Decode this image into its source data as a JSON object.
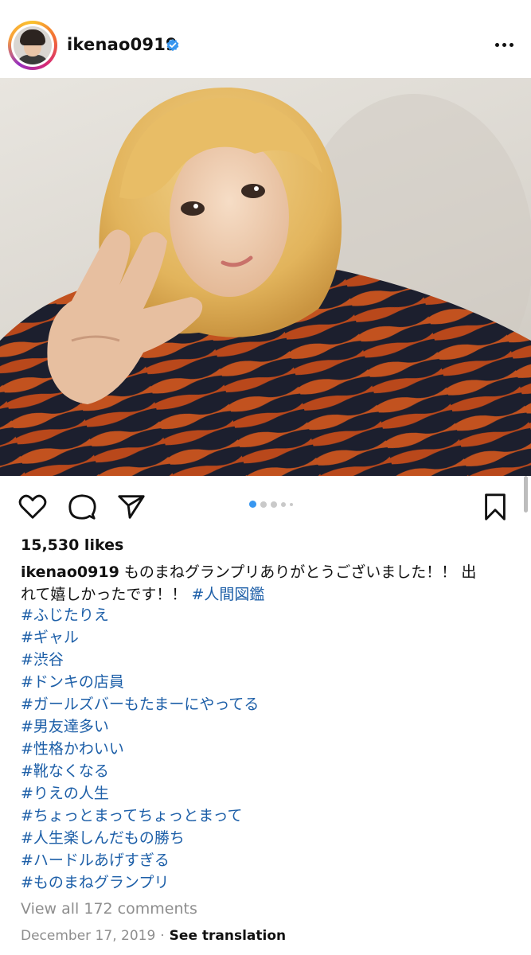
{
  "post": {
    "username": "ikenao0919",
    "photo_dots": 5,
    "likes": "15,530 likes",
    "caption_user": "ikenao0919",
    "caption_text_line1": " ものまねグランプリありがとうございました！！ 出",
    "caption_text_line2": "れて嬉しかったです！！ ",
    "caption_inline_tag": "#人間図鑑",
    "hashtags": [
      "#ふじたりえ",
      "#ギャル",
      "#渋谷",
      "#ドンキの店員",
      "#ガールズバーもたまーにやってる",
      "#男友達多い",
      "#性格かわいい",
      "#靴なくなる",
      "#りえの人生",
      "#ちょっとまってちょっとまって",
      "#人生楽しんだもの勝ち",
      "#ハードルあげすぎる",
      "#ものまねグランプリ"
    ],
    "view_comments": "View all 172 comments",
    "date": "December 17, 2019",
    "dot_sep": "·",
    "see_translation": "See translation"
  },
  "icons": {
    "verified": "verified-badge-icon",
    "more": "more-options-icon",
    "like": "heart-icon",
    "comment": "comment-bubble-icon",
    "share": "paper-plane-icon",
    "save": "bookmark-icon"
  },
  "colors": {
    "verified": "#3897f0",
    "hashtag": "#1d5fa8",
    "active_dot": "#3897f0",
    "muted": "#8e8e8e"
  }
}
